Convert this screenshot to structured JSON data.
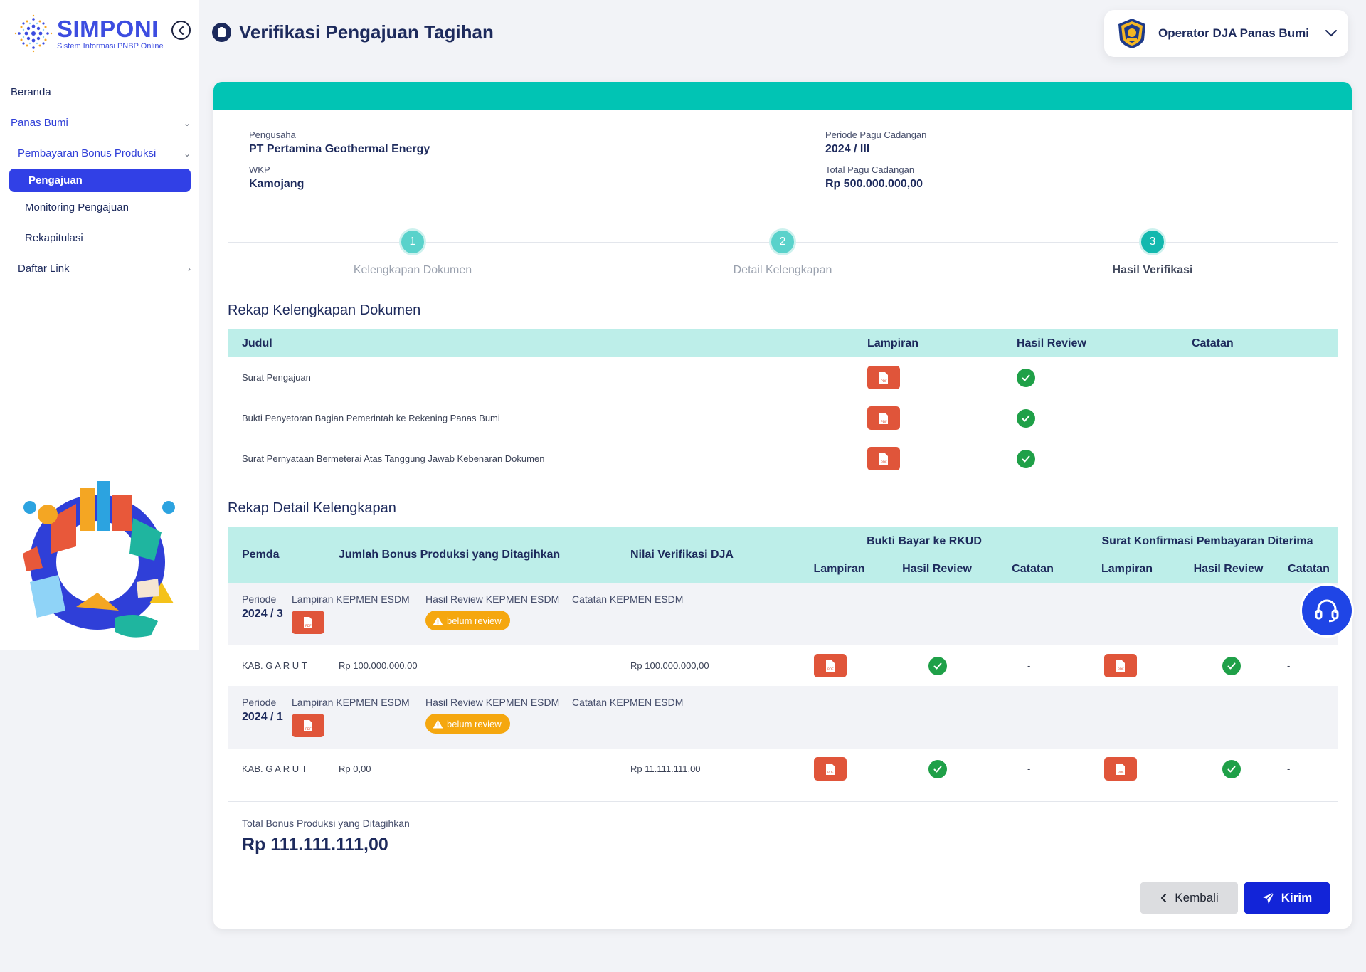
{
  "app": {
    "name": "SIMPONI",
    "subtitle": "Sistem Informasi PNBP Online"
  },
  "sidebar": {
    "items": [
      {
        "label": "Beranda",
        "level": 0
      },
      {
        "label": "Panas Bumi",
        "level": 0,
        "expanded": true
      },
      {
        "label": "Pembayaran Bonus Produksi",
        "level": 1,
        "expanded": true
      },
      {
        "label": "Pengajuan",
        "level": 2,
        "active": true
      },
      {
        "label": "Monitoring Pengajuan",
        "level": 2
      },
      {
        "label": "Rekapitulasi",
        "level": 2
      },
      {
        "label": "Daftar Link",
        "level": 1
      }
    ]
  },
  "header": {
    "title": "Verifikasi Pengajuan Tagihan",
    "user": "Operator DJA Panas Bumi"
  },
  "info": {
    "pengusaha_label": "Pengusaha",
    "pengusaha_value": "PT Pertamina Geothermal Energy",
    "wkp_label": "WKP",
    "wkp_value": "Kamojang",
    "periode_label": "Periode Pagu Cadangan",
    "periode_value": "2024 / III",
    "total_pagu_label": "Total Pagu Cadangan",
    "total_pagu_value": "Rp 500.000.000,00"
  },
  "stepper": {
    "steps": [
      {
        "number": "1",
        "label": "Kelengkapan Dokumen"
      },
      {
        "number": "2",
        "label": "Detail Kelengkapan"
      },
      {
        "number": "3",
        "label": "Hasil Verifikasi",
        "active": true
      }
    ]
  },
  "rekap_dokumen": {
    "title": "Rekap Kelengkapan Dokumen",
    "headers": {
      "judul": "Judul",
      "lampiran": "Lampiran",
      "hasil": "Hasil Review",
      "catatan": "Catatan"
    },
    "rows": [
      {
        "judul": "Surat Pengajuan"
      },
      {
        "judul": "Bukti Penyetoran Bagian Pemerintah ke Rekening Panas Bumi"
      },
      {
        "judul": "Surat Pernyataan Bermeterai Atas Tanggung Jawab Kebenaran Dokumen"
      }
    ]
  },
  "rekap_detail": {
    "title": "Rekap Detail Kelengkapan",
    "headers": {
      "pemda": "Pemda",
      "jumlah": "Jumlah Bonus Produksi yang Ditagihkan",
      "nilai": "Nilai Verifikasi DJA",
      "group1": "Bukti Bayar ke RKUD",
      "group2": "Surat Konfirmasi Pembayaran Diterima",
      "lampiran": "Lampiran",
      "hasil": "Hasil Review",
      "catatan": "Catatan"
    },
    "labels": {
      "periode": "Periode",
      "lampiran_kepmen": "Lampiran KEPMEN ESDM",
      "hasil_kepmen": "Hasil Review KEPMEN ESDM",
      "catatan_kepmen": "Catatan KEPMEN ESDM",
      "belum_review": "belum review"
    },
    "periods": [
      {
        "periode": "2024 / 3",
        "pemda": "KAB. G A R U T",
        "jumlah": "Rp 100.000.000,00",
        "nilai": "Rp 100.000.000,00",
        "catatan1": "-",
        "catatan2": "-"
      },
      {
        "periode": "2024 / 1",
        "pemda": "KAB. G A R U T",
        "jumlah": "Rp 0,00",
        "nilai": "Rp 11.111.111,00",
        "catatan1": "-",
        "catatan2": "-"
      }
    ]
  },
  "total": {
    "label": "Total Bonus Produksi yang Ditagihkan",
    "value": "Rp 111.111.111,00"
  },
  "actions": {
    "back": "Kembali",
    "send": "Kirim"
  },
  "colors": {
    "accent": "#3140e6",
    "teal": "#01c4b4",
    "table_header": "#bdeee9",
    "pdf": "#e0553a",
    "success": "#1fa048",
    "warning": "#f5a70f",
    "primary_button": "#1224d8"
  }
}
